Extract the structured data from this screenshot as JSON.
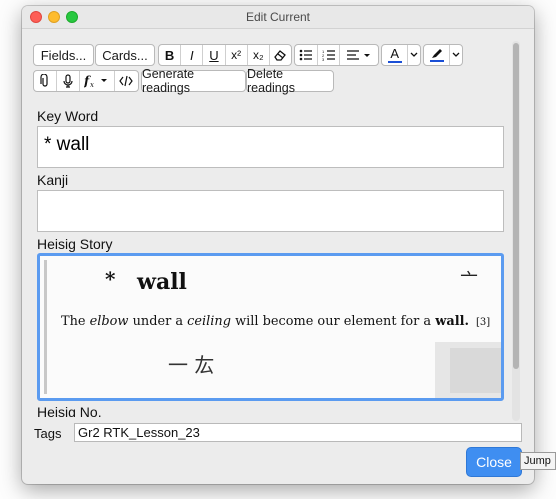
{
  "window": {
    "title": "Edit Current"
  },
  "toolbar": {
    "fields_label": "Fields...",
    "cards_label": "Cards...",
    "bold_label": "B",
    "italic_label": "I",
    "underline_label": "U",
    "superscript_label": "x²",
    "subscript_label": "x₂",
    "text_color_label": "A",
    "generate_label": "Generate readings",
    "delete_label": "Delete readings"
  },
  "fields": [
    {
      "name": "Key Word",
      "value": "* wall"
    },
    {
      "name": "Kanji",
      "value": ""
    },
    {
      "name": "Heisig Story",
      "value": ""
    },
    {
      "name": "Heisig No.",
      "value": ""
    }
  ],
  "story_image": {
    "asterisk": "*",
    "keyword": "wall",
    "glyph": "亠",
    "sentence_parts": [
      "The",
      "elbow",
      "under a",
      "ceiling",
      "will become our element for a",
      "wall."
    ],
    "frame_number": "[3]",
    "handwriting": "一 厷"
  },
  "tags": {
    "label": "Tags",
    "value": "Gr2 RTK_Lesson_23"
  },
  "close_label": "Close",
  "tooltip": "Jump",
  "colors": {
    "accent": "#3f8ef1",
    "text_color_underline": "#1a4fd6",
    "highlight_underline": "#1a4fd6"
  },
  "icons": [
    "eraser-icon",
    "bullet-list-icon",
    "numbered-list-icon",
    "align-icon",
    "paperclip-icon",
    "microphone-icon",
    "function-icon",
    "html-icon",
    "pen-icon"
  ]
}
